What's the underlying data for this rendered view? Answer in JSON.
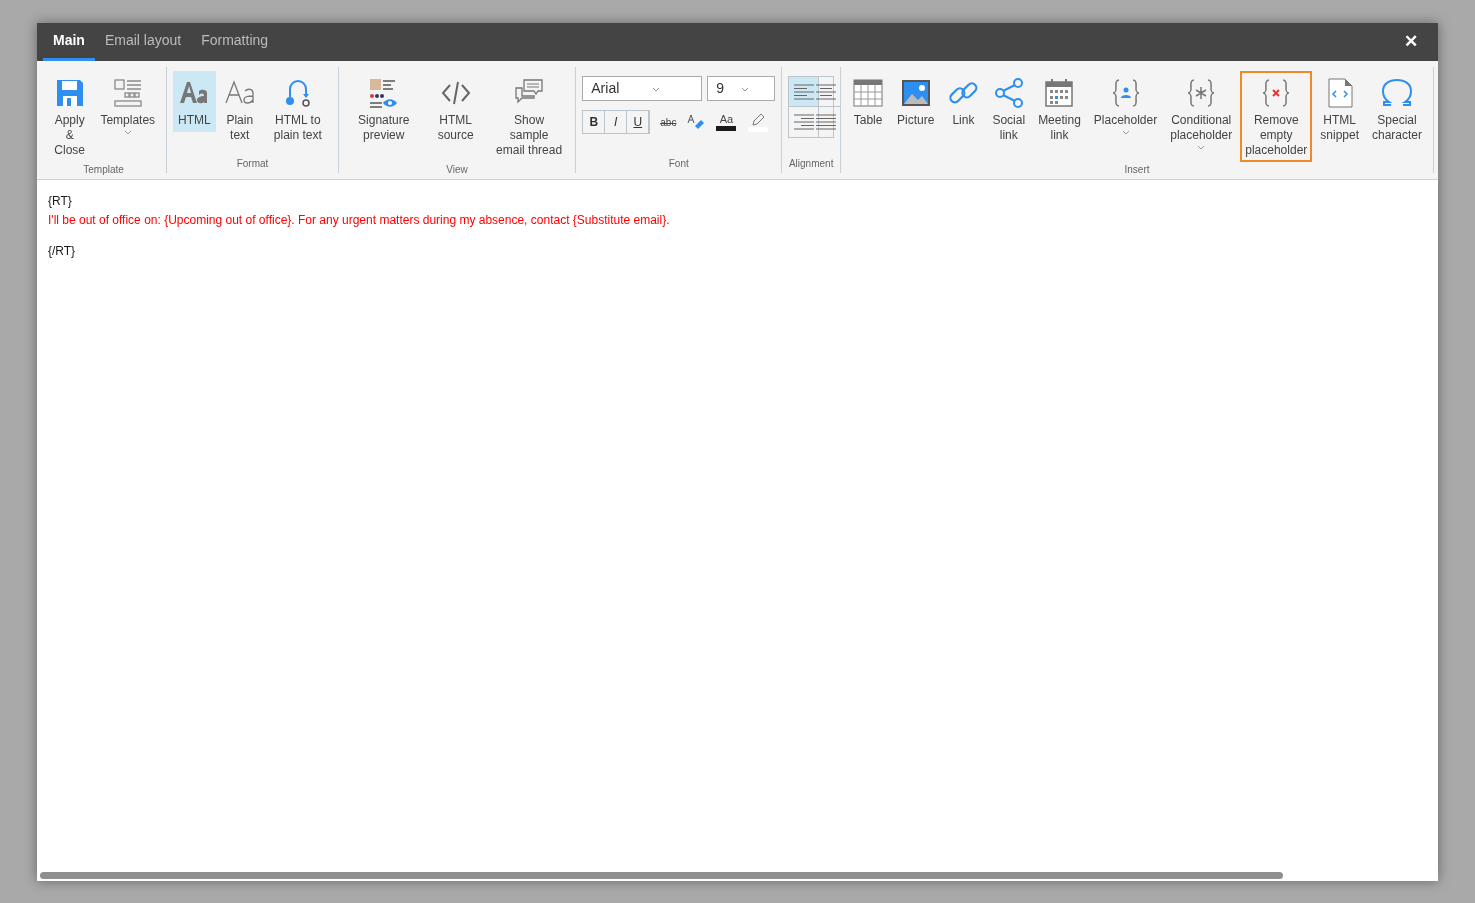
{
  "tabs": [
    {
      "label": "Main",
      "selected": true
    },
    {
      "label": "Email layout",
      "selected": false
    },
    {
      "label": "Formatting",
      "selected": false
    }
  ],
  "close": "✕",
  "ribbon": {
    "groups": [
      {
        "label": "Template",
        "buttons": [
          {
            "label": "Apply & Close",
            "selected": false,
            "dropdown": false,
            "highlighted": false
          },
          {
            "label": "Templates",
            "selected": false,
            "dropdown": true,
            "highlighted": false
          }
        ]
      },
      {
        "label": "Format",
        "buttons": [
          {
            "label": "HTML",
            "selected": true,
            "dropdown": false,
            "highlighted": false
          },
          {
            "label": "Plain text",
            "selected": false,
            "dropdown": false,
            "highlighted": false
          },
          {
            "label": "HTML to plain text",
            "selected": false,
            "dropdown": false,
            "highlighted": false
          }
        ]
      },
      {
        "label": "View",
        "buttons": [
          {
            "label": "Signature preview",
            "selected": false,
            "dropdown": false,
            "highlighted": false
          },
          {
            "label": "HTML source",
            "selected": false,
            "dropdown": false,
            "highlighted": false
          },
          {
            "label": "Show sample email thread",
            "selected": false,
            "dropdown": false,
            "highlighted": false
          }
        ]
      }
    ],
    "font": {
      "label": "Font",
      "family": "Arial",
      "size": "9",
      "styles": [
        {
          "label": "B",
          "on": false
        },
        {
          "label": "I",
          "on": false
        },
        {
          "label": "U",
          "on": false
        }
      ],
      "strike": "abc",
      "color_sample": "Aa"
    },
    "alignment": {
      "label": "Alignment",
      "options": [
        {
          "selected": true
        },
        {
          "selected": false
        },
        {
          "selected": false
        },
        {
          "selected": false
        }
      ]
    },
    "insert": {
      "label": "Insert",
      "buttons": [
        {
          "label": "Table",
          "dropdown": false,
          "highlighted": false
        },
        {
          "label": "Picture",
          "dropdown": false,
          "highlighted": false
        },
        {
          "label": "Link",
          "dropdown": false,
          "highlighted": false
        },
        {
          "label": "Social link",
          "dropdown": false,
          "highlighted": false
        },
        {
          "label": "Meeting link",
          "dropdown": false,
          "highlighted": false
        },
        {
          "label": "Placeholder",
          "dropdown": true,
          "highlighted": false
        },
        {
          "label": "Conditional placeholder",
          "dropdown": true,
          "highlighted": false
        },
        {
          "label": "Remove empty placeholder",
          "dropdown": false,
          "highlighted": true
        },
        {
          "label": "HTML snippet",
          "dropdown": false,
          "highlighted": false
        },
        {
          "label": "Special character",
          "dropdown": false,
          "highlighted": false
        }
      ]
    }
  },
  "editor": {
    "lines": [
      {
        "text": "{RT}",
        "color": "#1a1a1a"
      },
      {
        "text": "I'll be out of office on: {Upcoming out of office}. For any urgent matters during my absence, contact {Substitute email}.",
        "color": "#ff0000"
      },
      {
        "text": "{/RT}",
        "color": "#1a1a1a"
      }
    ]
  }
}
